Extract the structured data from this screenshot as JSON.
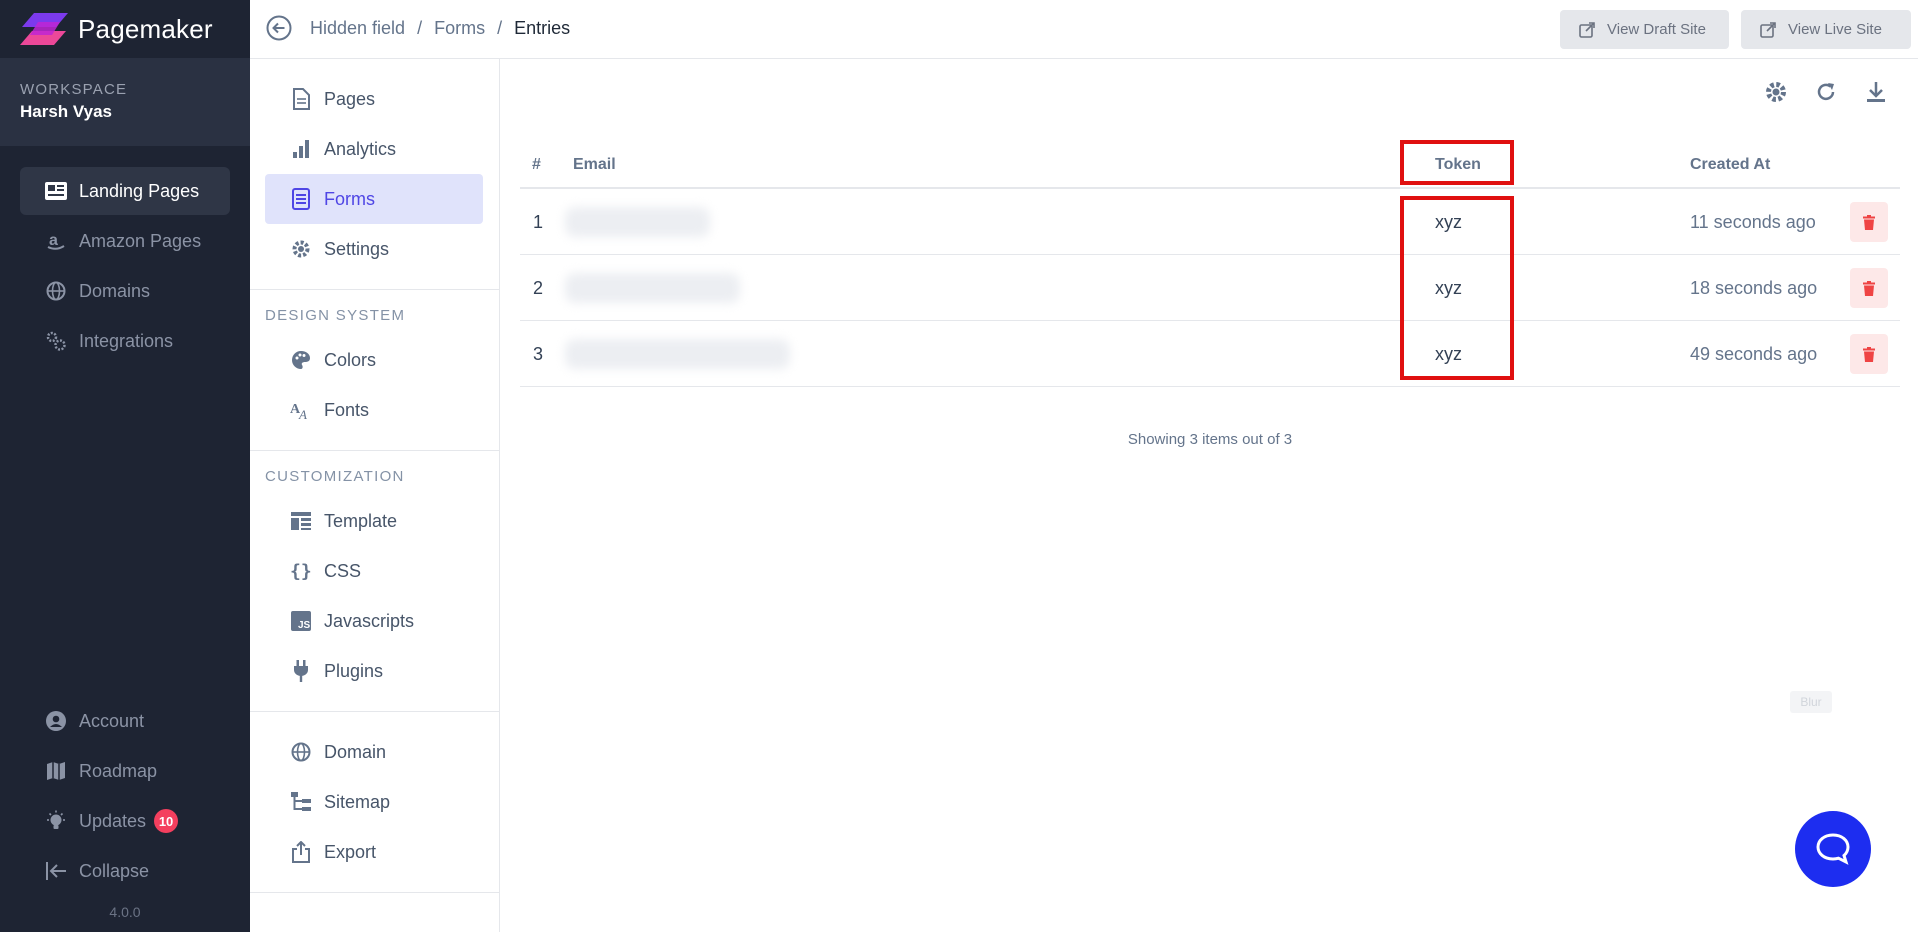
{
  "app": {
    "name": "Pagemaker",
    "version": "4.0.0",
    "colors": {
      "sidebar": "#1e2433",
      "accent": "#4f46e5",
      "danger": "#ef4444",
      "highlight_box": "#e01010",
      "chat": "#1d2df0"
    }
  },
  "workspace": {
    "label": "WORKSPACE",
    "name": "Harsh Vyas"
  },
  "main_nav": [
    {
      "label": "Landing Pages",
      "icon": "newspaper-icon",
      "active": true
    },
    {
      "label": "Amazon Pages",
      "icon": "amazon-icon",
      "active": false
    },
    {
      "label": "Domains",
      "icon": "globe-icon",
      "active": false
    },
    {
      "label": "Integrations",
      "icon": "gears-icon",
      "active": false
    }
  ],
  "bottom_nav": [
    {
      "label": "Account",
      "icon": "user-circle-icon"
    },
    {
      "label": "Roadmap",
      "icon": "map-icon"
    },
    {
      "label": "Updates",
      "icon": "lightbulb-icon",
      "badge": "10"
    },
    {
      "label": "Collapse",
      "icon": "collapse-icon"
    }
  ],
  "breadcrumb": {
    "items": [
      "Hidden field",
      "Forms"
    ],
    "current": "Entries"
  },
  "top_actions": {
    "draft": "View Draft Site",
    "live": "View Live Site"
  },
  "sub_nav": {
    "primary": [
      {
        "label": "Pages",
        "icon": "file-icon"
      },
      {
        "label": "Analytics",
        "icon": "bar-chart-icon"
      },
      {
        "label": "Forms",
        "icon": "form-icon",
        "active": true
      },
      {
        "label": "Settings",
        "icon": "gear-icon"
      }
    ],
    "design_heading": "DESIGN SYSTEM",
    "design": [
      {
        "label": "Colors",
        "icon": "palette-icon"
      },
      {
        "label": "Fonts",
        "icon": "font-icon"
      }
    ],
    "custom_heading": "CUSTOMIZATION",
    "custom": [
      {
        "label": "Template",
        "icon": "template-icon"
      },
      {
        "label": "CSS",
        "icon": "braces-icon"
      },
      {
        "label": "Javascripts",
        "icon": "js-icon"
      },
      {
        "label": "Plugins",
        "icon": "plug-icon"
      }
    ],
    "extra": [
      {
        "label": "Domain",
        "icon": "globe-icon"
      },
      {
        "label": "Sitemap",
        "icon": "sitemap-icon"
      },
      {
        "label": "Export",
        "icon": "export-icon"
      }
    ]
  },
  "table": {
    "columns": {
      "index": "#",
      "email": "Email",
      "token": "Token",
      "created": "Created At"
    },
    "rows": [
      {
        "index": "1",
        "token": "xyz",
        "created": "11 seconds ago"
      },
      {
        "index": "2",
        "token": "xyz",
        "created": "18 seconds ago"
      },
      {
        "index": "3",
        "token": "xyz",
        "created": "49 seconds ago"
      }
    ],
    "footer": "Showing 3 items out of 3"
  },
  "overlay": {
    "blur_label": "Blur"
  }
}
